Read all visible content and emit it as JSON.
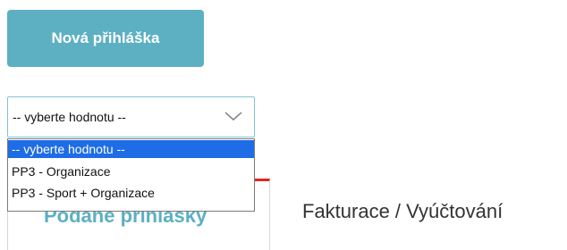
{
  "actions": {
    "new_application_label": "Nová přihláška"
  },
  "select": {
    "value": "-- vyberte hodnotu --",
    "options": [
      "-- vyberte hodnotu --",
      "PP3 - Organizace",
      "PP3 - Sport + Organizace"
    ],
    "selected_index": 0,
    "chevron_icon": "chevron-down-icon"
  },
  "tabs": [
    {
      "label": "Podané přihlášky",
      "active": true
    },
    {
      "label": "Fakturace / Vyúčtování",
      "active": false
    }
  ],
  "colors": {
    "accent": "#5cb0c2",
    "selected_option": "#1e6ce6",
    "active_tab_border": "#e2271d"
  }
}
